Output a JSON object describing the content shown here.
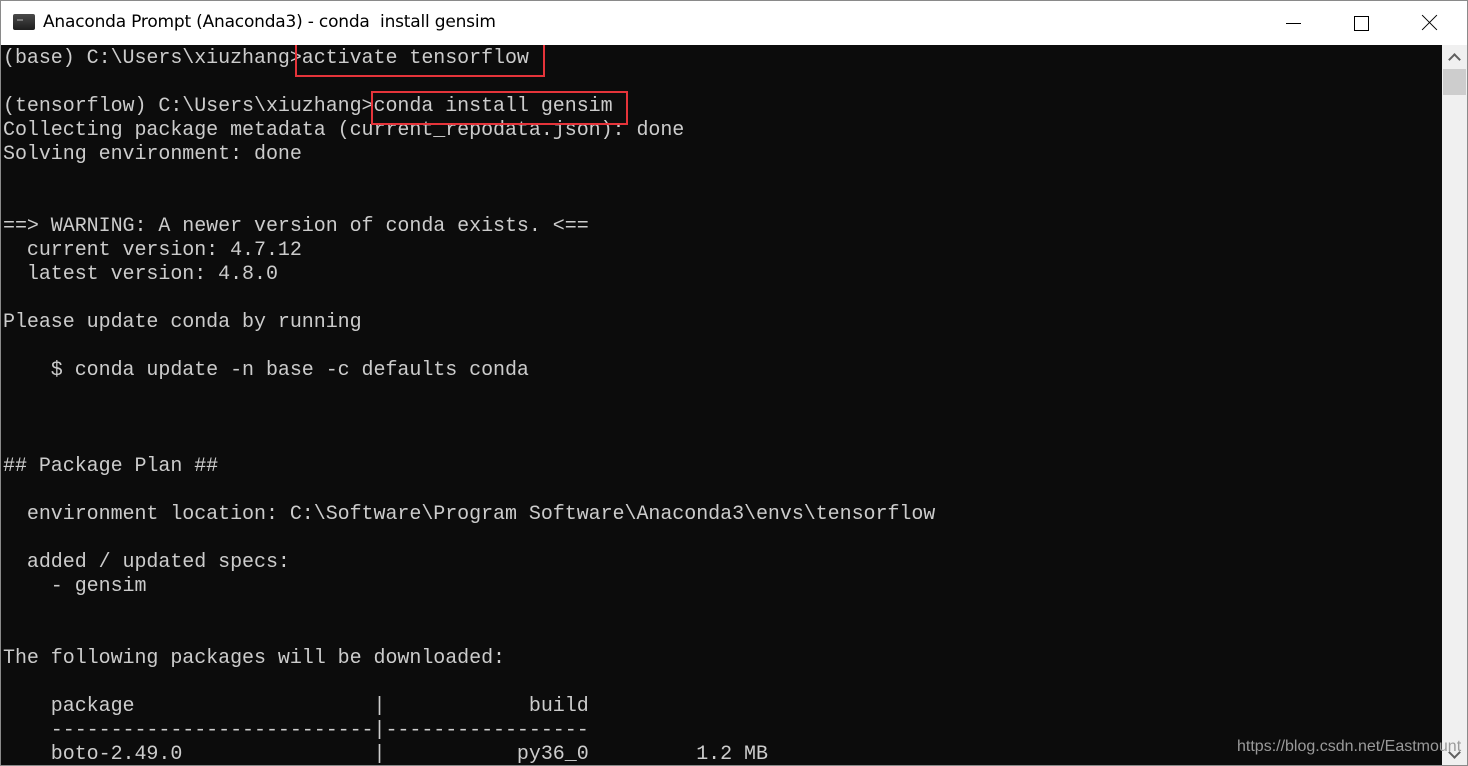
{
  "window": {
    "title": "Anaconda Prompt (Anaconda3) - conda  install gensim",
    "icon": "terminal-icon",
    "controls": {
      "minimize": "minimize-icon",
      "maximize": "maximize-icon",
      "close": "close-icon"
    }
  },
  "console": {
    "lines": [
      {
        "text": "(base) C:\\Users\\xiuzhang>activate tensorflow"
      },
      {
        "text": ""
      },
      {
        "text": "(tensorflow) C:\\Users\\xiuzhang>conda install gensim"
      },
      {
        "text": "Collecting package metadata (current_repodata.json): done"
      },
      {
        "text": "Solving environment: done"
      },
      {
        "text": ""
      },
      {
        "text": ""
      },
      {
        "text": "==> WARNING: A newer version of conda exists. <=="
      },
      {
        "text": "  current version: 4.7.12"
      },
      {
        "text": "  latest version: 4.8.0"
      },
      {
        "text": ""
      },
      {
        "text": "Please update conda by running"
      },
      {
        "text": ""
      },
      {
        "text": "    $ conda update -n base -c defaults conda"
      },
      {
        "text": ""
      },
      {
        "text": ""
      },
      {
        "text": ""
      },
      {
        "text": "## Package Plan ##"
      },
      {
        "text": ""
      },
      {
        "text": "  environment location: C:\\Software\\Program Software\\Anaconda3\\envs\\tensorflow"
      },
      {
        "text": ""
      },
      {
        "text": "  added / updated specs:"
      },
      {
        "text": "    - gensim"
      },
      {
        "text": ""
      },
      {
        "text": ""
      },
      {
        "text": "The following packages will be downloaded:"
      },
      {
        "text": ""
      },
      {
        "text": "    package                    |            build"
      },
      {
        "text": "    ---------------------------|-----------------"
      },
      {
        "text": "    boto-2.49.0                |           py36_0         1.2 MB"
      }
    ],
    "highlighted_commands": [
      "activate tensorflow",
      "conda install gensim"
    ],
    "highlight_color": "#e5343a"
  },
  "watermark": "https://blog.csdn.net/Eastmount"
}
